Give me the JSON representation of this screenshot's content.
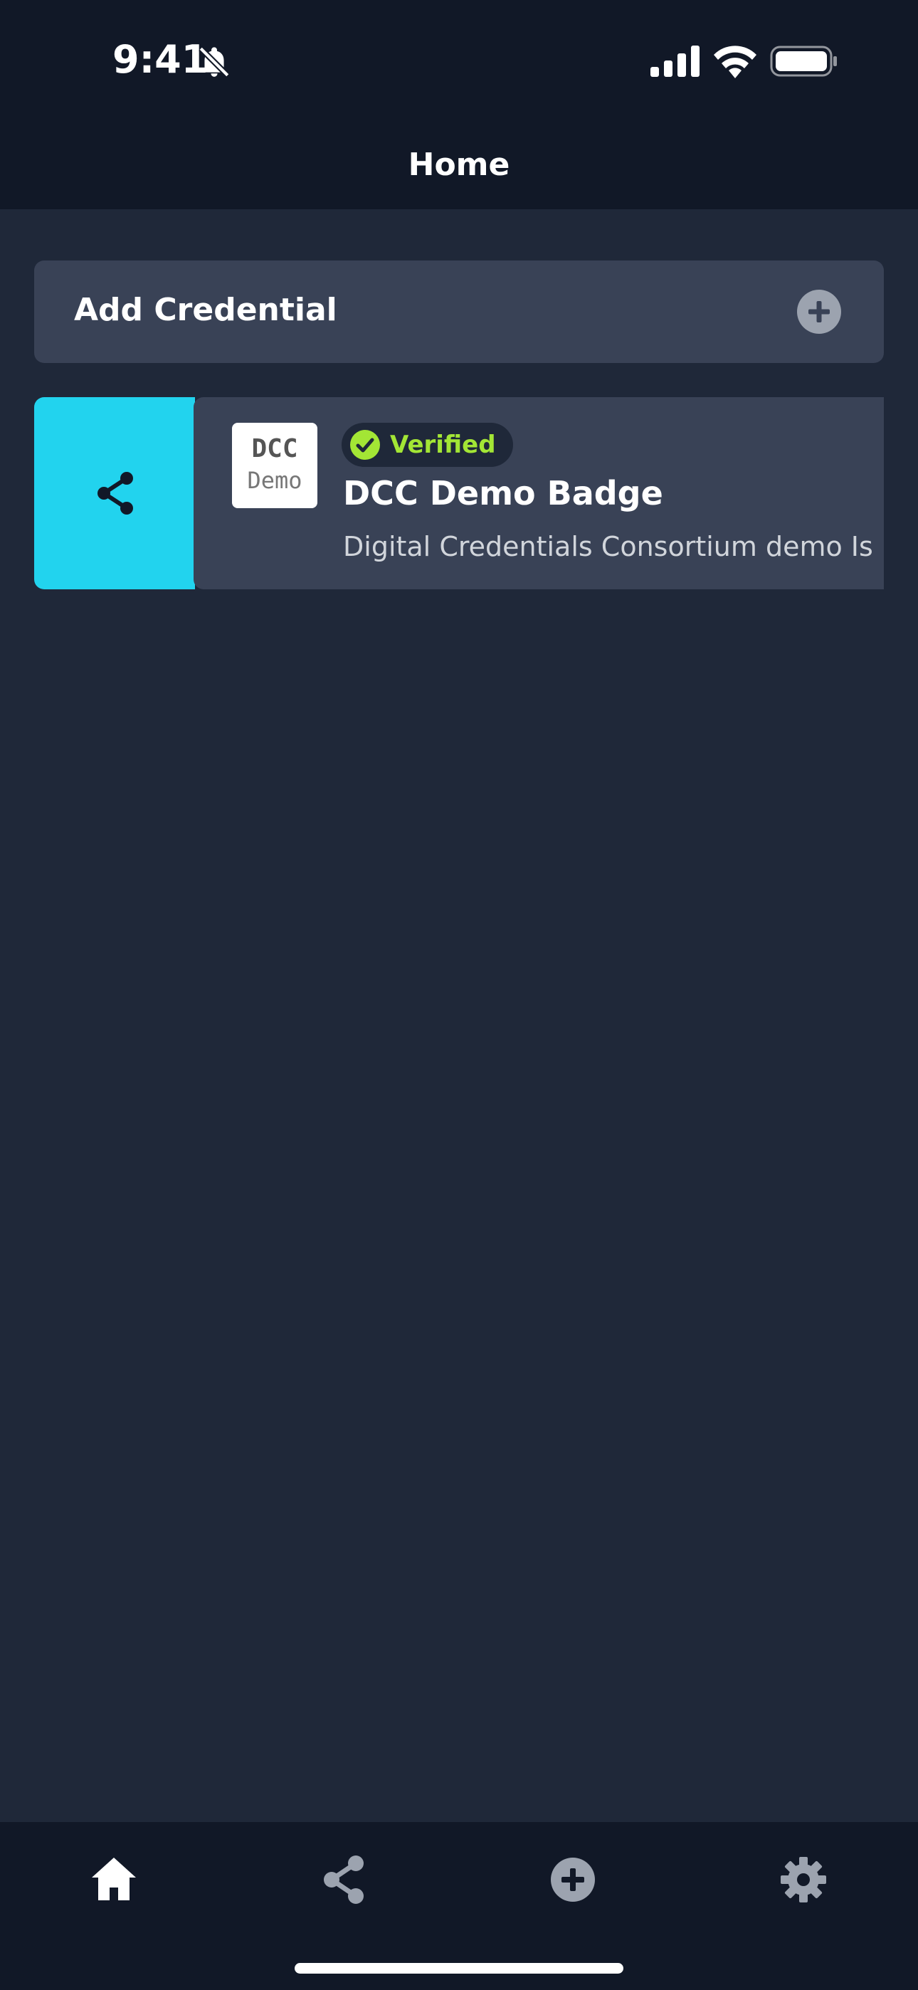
{
  "status_bar": {
    "time": "9:41",
    "icons": [
      "bell-slash-icon",
      "signal-icon",
      "wifi-icon",
      "battery-icon"
    ]
  },
  "header": {
    "title": "Home"
  },
  "add_credential": {
    "label": "Add Credential",
    "icon": "plus-circle-icon"
  },
  "credentials": [
    {
      "logo_line1": "DCC",
      "logo_line2": "Demo",
      "status": "Verified",
      "title": "DCC Demo Badge",
      "subtitle": "Digital Credentials Consortium demo Is",
      "swipe_action_icon": "share-icon"
    }
  ],
  "tab_bar": {
    "tabs": [
      {
        "icon": "home-icon",
        "active": true
      },
      {
        "icon": "share-icon",
        "active": false
      },
      {
        "icon": "plus-circle-icon",
        "active": false
      },
      {
        "icon": "gear-icon",
        "active": false
      }
    ]
  },
  "colors": {
    "background": "#1f2839",
    "header_bg": "#111827",
    "card_bg": "#394256",
    "share_action": "#22d3ee",
    "verified_text": "#a3e635",
    "inactive_icon": "#9ca3af"
  }
}
